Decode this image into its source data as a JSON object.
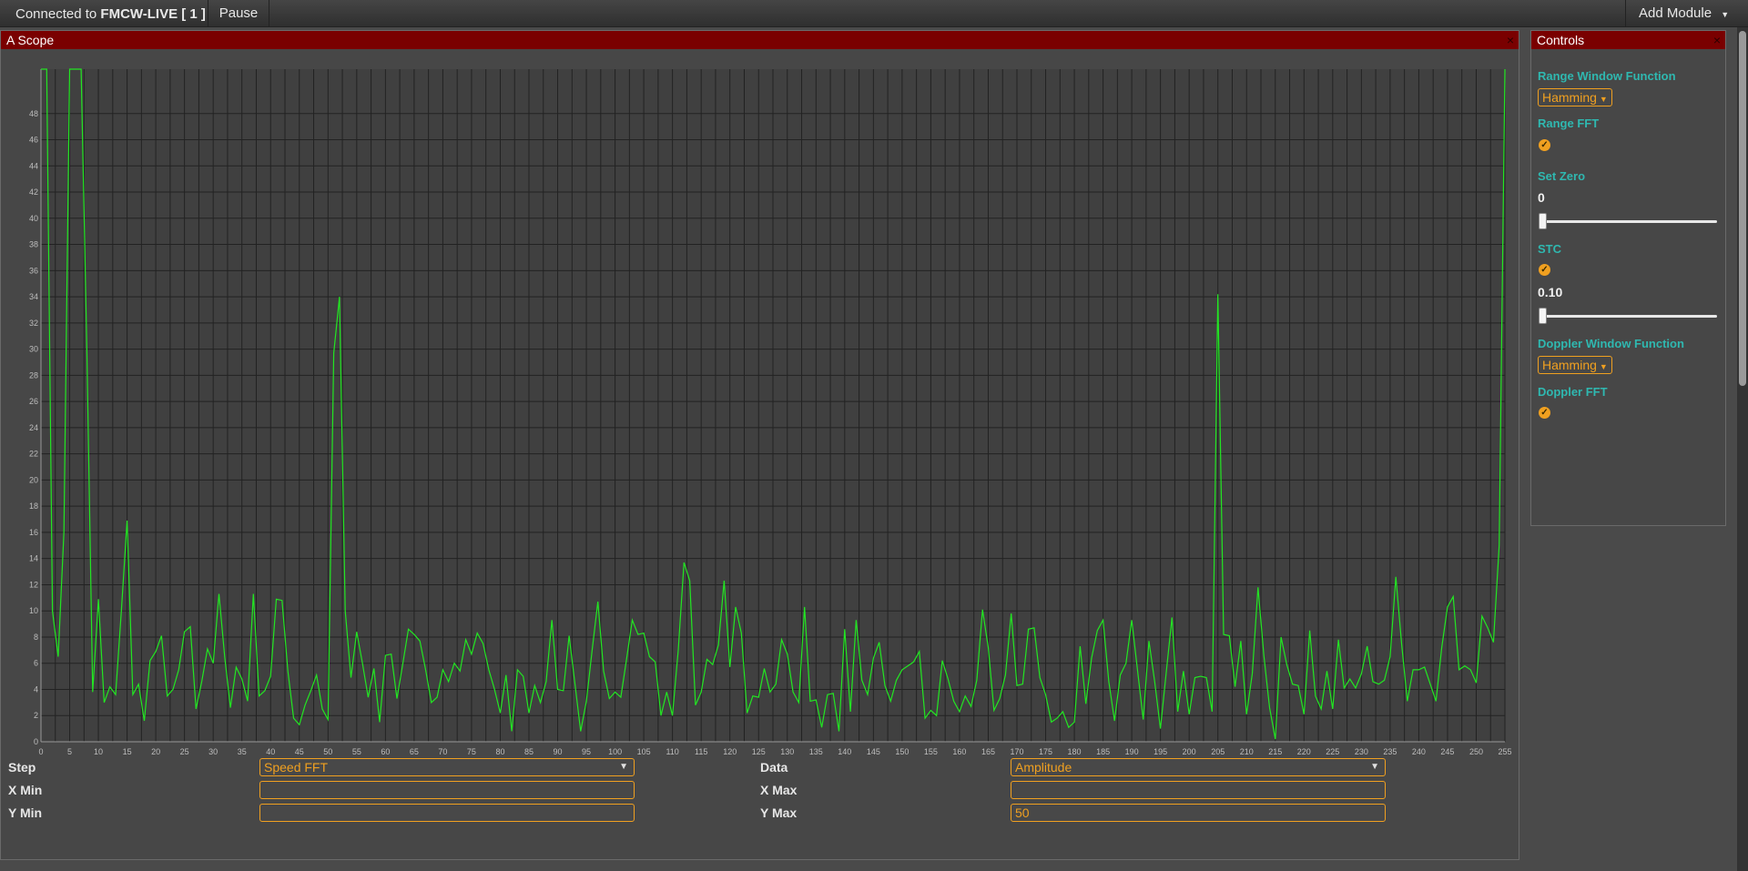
{
  "topbar": {
    "connected_prefix": "Connected to",
    "connection_name": "FMCW-LIVE [ 1 ]",
    "pause_label": "Pause",
    "add_module_label": "Add Module"
  },
  "scope_panel": {
    "title": "A Scope",
    "close_glyph": "×",
    "form": {
      "step_label": "Step",
      "step_value": "Speed FFT",
      "data_label": "Data",
      "data_value": "Amplitude",
      "xmin_label": "X Min",
      "xmin_value": "",
      "xmax_label": "X Max",
      "xmax_value": "",
      "ymin_label": "Y Min",
      "ymin_value": "",
      "ymax_label": "Y Max",
      "ymax_value": "50"
    }
  },
  "controls_panel": {
    "title": "Controls",
    "close_glyph": "×",
    "range_window_label": "Range Window Function",
    "range_window_value": "Hamming",
    "range_fft_label": "Range FFT",
    "range_fft_checked": true,
    "set_zero_label": "Set Zero",
    "set_zero_value": "0",
    "stc_label": "STC",
    "stc_checked": true,
    "stc_value": "0.10",
    "doppler_window_label": "Doppler Window Function",
    "doppler_window_value": "Hamming",
    "doppler_fft_label": "Doppler FFT",
    "doppler_fft_checked": true
  },
  "colors": {
    "line": "#22e622",
    "accent": "#f0a020",
    "header": "#7a0000",
    "label": "#2fb8b0"
  },
  "chart_data": {
    "type": "line",
    "xlim": [
      0,
      255
    ],
    "ylim": [
      0,
      50
    ],
    "x_ticks": [
      0,
      5,
      10,
      15,
      20,
      25,
      30,
      35,
      40,
      45,
      50,
      55,
      60,
      65,
      70,
      75,
      80,
      85,
      90,
      95,
      100,
      105,
      110,
      115,
      120,
      125,
      130,
      135,
      140,
      145,
      150,
      155,
      160,
      165,
      170,
      175,
      180,
      185,
      190,
      195,
      200,
      205,
      210,
      215,
      220,
      225,
      230,
      235,
      240,
      245,
      250,
      255
    ],
    "y_ticks": [
      0,
      2,
      4,
      6,
      8,
      10,
      12,
      14,
      16,
      18,
      20,
      22,
      24,
      26,
      28,
      30,
      32,
      34,
      36,
      38,
      40,
      42,
      44,
      46,
      48
    ],
    "grid": true,
    "series": [
      {
        "values": [
          50,
          50,
          10,
          6.5,
          16,
          50,
          50,
          50,
          30,
          3.8,
          10.9,
          3,
          4.2,
          3.6,
          10,
          16.9,
          3.6,
          4.4,
          1.6,
          6.2,
          6.9,
          8.1,
          3.5,
          4,
          5.5,
          8.4,
          8.8,
          2.5,
          4.6,
          7.1,
          6,
          11.3,
          6.5,
          2.6,
          5.7,
          4.8,
          3.1,
          11.3,
          3.5,
          3.9,
          5,
          10.9,
          10.8,
          5.4,
          1.8,
          1.3,
          2.8,
          3.9,
          5.1,
          2.5,
          1.7,
          29.7,
          34,
          10,
          4.9,
          8.4,
          6,
          3.4,
          5.6,
          1.5,
          6.6,
          6.7,
          3.3,
          5.9,
          8.6,
          8.2,
          7.7,
          5.5,
          3,
          3.4,
          5.5,
          4.6,
          6,
          5.4,
          7.8,
          6.7,
          8.3,
          7.5,
          5.5,
          4,
          2.2,
          5.1,
          0.8,
          5.5,
          5,
          2.2,
          4.3,
          3,
          4.6,
          9.3,
          4,
          3.9,
          8.1,
          4.5,
          0.8,
          3.1,
          7,
          10.7,
          5.4,
          3.3,
          3.8,
          3.4,
          6.3,
          9.3,
          8.2,
          8.3,
          6.5,
          6.1,
          2,
          3.8,
          2,
          7,
          13.7,
          12.3,
          2.8,
          3.8,
          6.3,
          5.9,
          7.4,
          12.3,
          5.7,
          10.3,
          8.3,
          2.2,
          3.5,
          3.4,
          5.6,
          3.8,
          4.4,
          7.8,
          6.7,
          3.8,
          3,
          10.3,
          3.1,
          3.2,
          1.1,
          3.6,
          3.7,
          0.8,
          8.6,
          2.3,
          9.3,
          4.7,
          3.6,
          6.4,
          7.6,
          4.3,
          3.1,
          4.7,
          5.5,
          5.8,
          6.1,
          6.9,
          1.8,
          2.4,
          2,
          6.2,
          4.8,
          3.1,
          2.3,
          3.5,
          2.7,
          4.7,
          10.1,
          7.2,
          2.4,
          3.3,
          5.1,
          9.8,
          4.3,
          4.4,
          8.6,
          8.7,
          4.9,
          3.6,
          1.5,
          1.8,
          2.3,
          1.1,
          1.5,
          7.3,
          2.9,
          6.4,
          8.5,
          9.3,
          4.6,
          1.6,
          5.1,
          6,
          9.3,
          5.5,
          1.7,
          7.7,
          4.6,
          1,
          5.3,
          9.5,
          2.3,
          5.4,
          2.1,
          4.9,
          5,
          4.9,
          2.3,
          34.2,
          8.2,
          8.1,
          4.2,
          7.7,
          2.1,
          5.2,
          11.8,
          6.6,
          2.6,
          0.2,
          8,
          5.9,
          4.4,
          4.3,
          2.1,
          8.5,
          3.5,
          2.5,
          5.4,
          2.5,
          7.8,
          4.1,
          4.8,
          4.1,
          5.2,
          7.3,
          4.6,
          4.4,
          4.7,
          6.5,
          12.6,
          7.5,
          3.1,
          5.5,
          5.5,
          5.7,
          4.4,
          3.1,
          7.2,
          10.3,
          11.1,
          5.5,
          5.8,
          5.5,
          4.5,
          9.6,
          8.7,
          7.6,
          15,
          50
        ]
      }
    ]
  }
}
